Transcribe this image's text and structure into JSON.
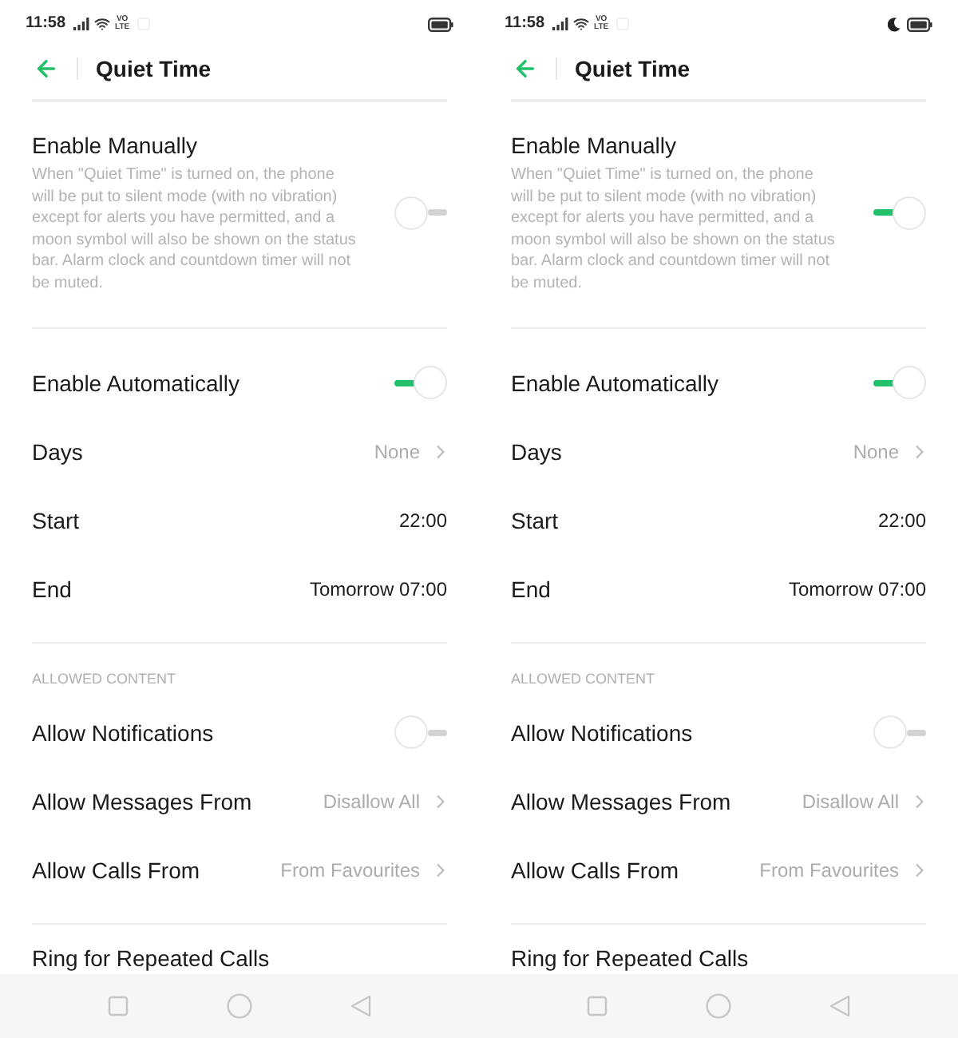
{
  "screens": [
    {
      "status_bar": {
        "time": "11:58",
        "network": [
          "VO",
          "LTE"
        ],
        "moon": false
      },
      "title": "Quiet Time",
      "manual": {
        "label": "Enable Manually",
        "description": "When \"Quiet Time\" is turned on, the phone will be put to silent mode (with no vibration) except for alerts you have permitted, and a moon symbol will also be shown on the status bar. Alarm clock and countdown timer will not be muted.",
        "on": false
      },
      "schedule": [
        {
          "kind": "toggle",
          "label": "Enable Automatically",
          "on": true
        },
        {
          "kind": "link",
          "label": "Days",
          "value": "None"
        },
        {
          "kind": "value",
          "label": "Start",
          "value": "22:00"
        },
        {
          "kind": "value",
          "label": "End",
          "value": "Tomorrow 07:00"
        }
      ],
      "allowed": {
        "heading": "ALLOWED CONTENT",
        "rows": [
          {
            "kind": "toggle",
            "label": "Allow Notifications",
            "on": false
          },
          {
            "kind": "link",
            "label": "Allow Messages From",
            "value": "Disallow All"
          },
          {
            "kind": "link",
            "label": "Allow Calls From",
            "value": "From Favourites"
          }
        ]
      },
      "more": [
        {
          "label": "Ring for Repeated Calls"
        }
      ]
    },
    {
      "status_bar": {
        "time": "11:58",
        "network": [
          "VO",
          "LTE"
        ],
        "moon": true
      },
      "title": "Quiet Time",
      "manual": {
        "label": "Enable Manually",
        "description": "When \"Quiet Time\" is turned on, the phone will be put to silent mode (with no vibration) except for alerts you have permitted, and a moon symbol will also be shown on the status bar. Alarm clock and countdown timer will not be muted.",
        "on": true
      },
      "schedule": [
        {
          "kind": "toggle",
          "label": "Enable Automatically",
          "on": true
        },
        {
          "kind": "link",
          "label": "Days",
          "value": "None"
        },
        {
          "kind": "value",
          "label": "Start",
          "value": "22:00"
        },
        {
          "kind": "value",
          "label": "End",
          "value": "Tomorrow 07:00"
        }
      ],
      "allowed": {
        "heading": "ALLOWED CONTENT",
        "rows": [
          {
            "kind": "toggle",
            "label": "Allow Notifications",
            "on": false
          },
          {
            "kind": "link",
            "label": "Allow Messages From",
            "value": "Disallow All"
          },
          {
            "kind": "link",
            "label": "Allow Calls From",
            "value": "From Favourites"
          }
        ]
      },
      "more": [
        {
          "label": "Ring for Repeated Calls"
        }
      ]
    }
  ]
}
